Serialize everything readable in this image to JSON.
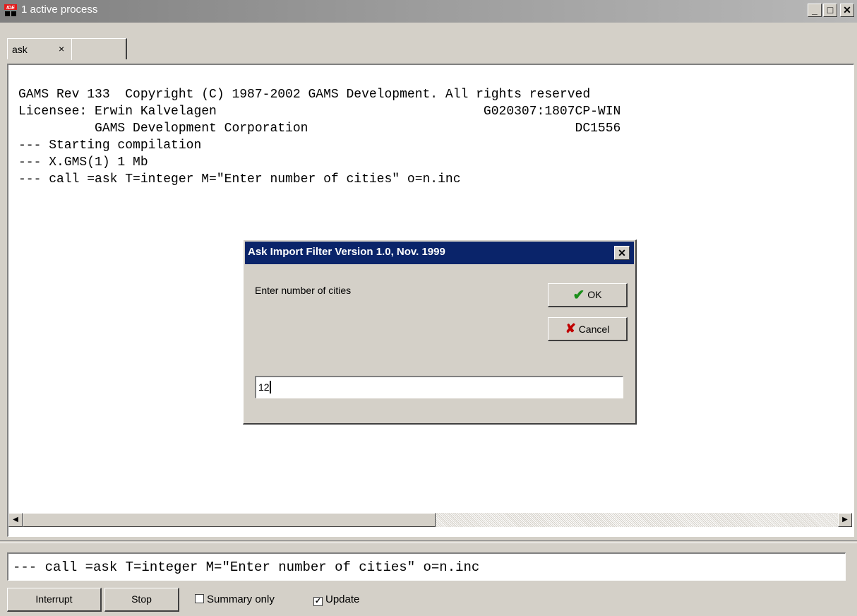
{
  "window": {
    "title": "1 active process",
    "minimize_glyph": "_",
    "maximize_glyph": "□",
    "close_glyph": "✕",
    "app_icon_text": "IDE"
  },
  "tabs": [
    {
      "label": "ask",
      "close_glyph": "×"
    }
  ],
  "log": {
    "lines": [
      "GAMS Rev 133  Copyright (C) 1987-2002 GAMS Development. All rights reserved",
      "Licensee: Erwin Kalvelagen                                   G020307:1807CP-WIN",
      "          GAMS Development Corporation                                   DC1556",
      "--- Starting compilation",
      "--- X.GMS(1) 1 Mb",
      "--- call =ask T=integer M=\"Enter number of cities\" o=n.inc"
    ]
  },
  "dialog": {
    "title": "Ask Import Filter Version 1.0, Nov. 1999",
    "close_glyph": "✕",
    "prompt": "Enter number of cities",
    "ok_label": "OK",
    "cancel_label": "Cancel",
    "input_value": "12"
  },
  "status_line": "--- call =ask T=integer M=\"Enter number of cities\" o=n.inc",
  "controls": {
    "interrupt_label": "Interrupt",
    "stop_label": "Stop",
    "summary_only_label": "Summary only",
    "summary_only_checked": false,
    "update_label": "Update",
    "update_checked": true
  },
  "colors": {
    "dialog_title_bg": "#0a246a",
    "ok_check": "#1a8f1a",
    "cancel_x": "#c00000",
    "icon_red": "#e21b1b"
  }
}
